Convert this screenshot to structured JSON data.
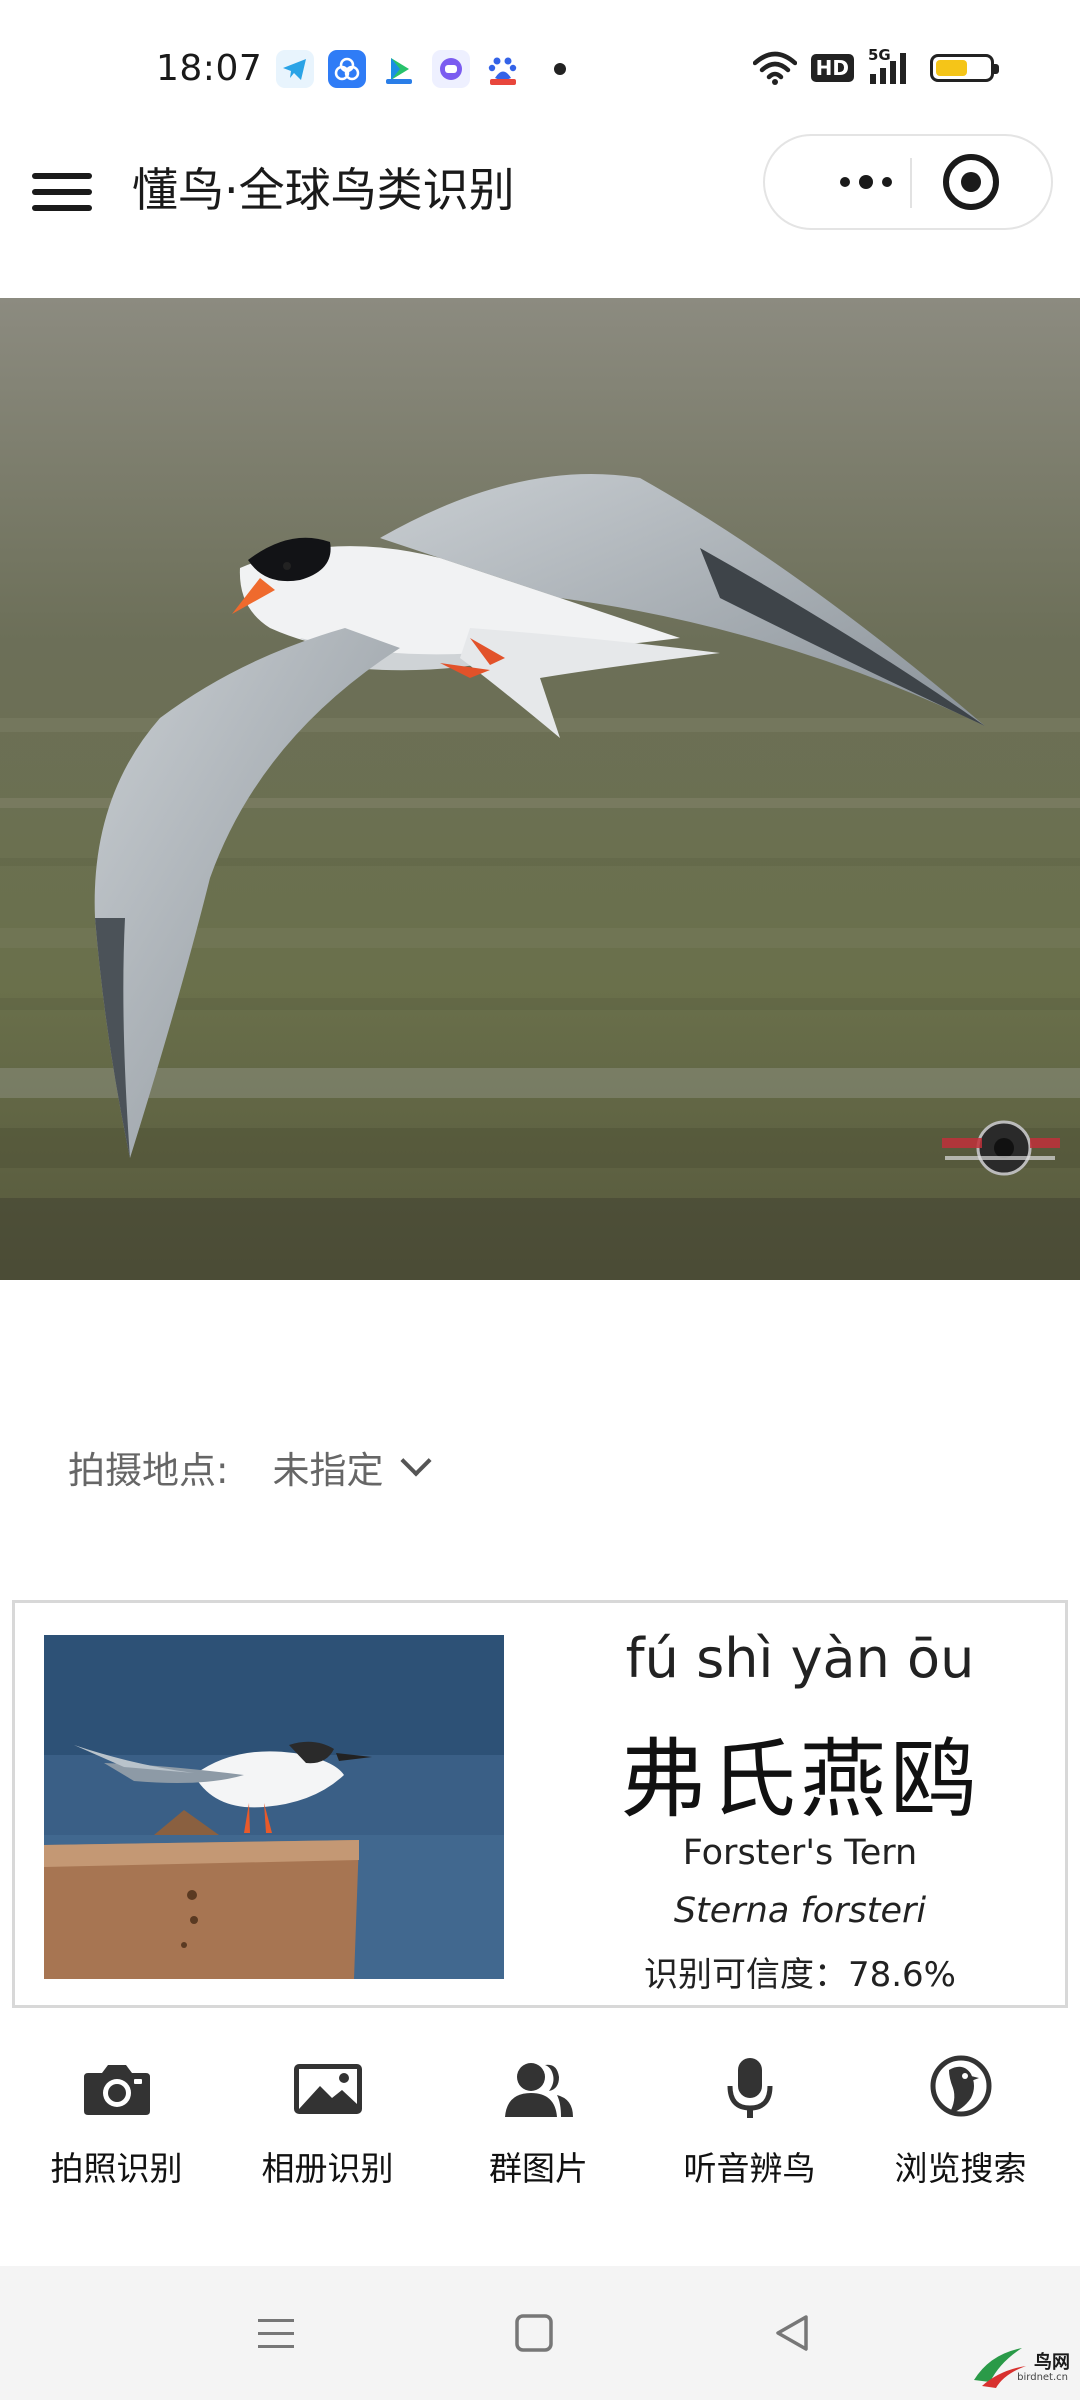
{
  "status_bar": {
    "time": "18:07",
    "network": "5G",
    "hd": "HD",
    "battery_level": 0.6,
    "app_icons": [
      "telegram-icon",
      "circle-app-icon",
      "video-app-icon",
      "message-app-icon",
      "baidu-app-icon"
    ],
    "colors": {
      "battery_fill": "#f5c518"
    }
  },
  "header": {
    "title": "懂鸟·全球鸟类识别",
    "menu_icon": "hamburger-icon",
    "capsule": {
      "more_icon": "more-dots-icon",
      "close_icon": "close-target-icon"
    }
  },
  "hero": {
    "subject": "tern-in-flight-photo",
    "watermark": "photographer-logo"
  },
  "location": {
    "label": "拍摄地点:",
    "value": "未指定"
  },
  "result": {
    "pinyin": "fú shì yàn ōu",
    "chinese_name": "弗氏燕鸥",
    "english_name": "Forster's Tern",
    "scientific_name": "Sterna forsteri",
    "confidence": "识别可信度：78.6%"
  },
  "actions": [
    {
      "label": "拍照识别",
      "icon": "camera-icon"
    },
    {
      "label": "相册识别",
      "icon": "image-icon"
    },
    {
      "label": "群图片",
      "icon": "group-icon"
    },
    {
      "label": "听音辨鸟",
      "icon": "microphone-icon"
    },
    {
      "label": "浏览搜索",
      "icon": "bird-search-icon"
    }
  ],
  "nav_bar": {
    "buttons": [
      "menu-nav-icon",
      "home-nav-icon",
      "back-nav-icon"
    ],
    "watermark": {
      "text": "鸟网",
      "sub": "birdnet.cn"
    }
  }
}
